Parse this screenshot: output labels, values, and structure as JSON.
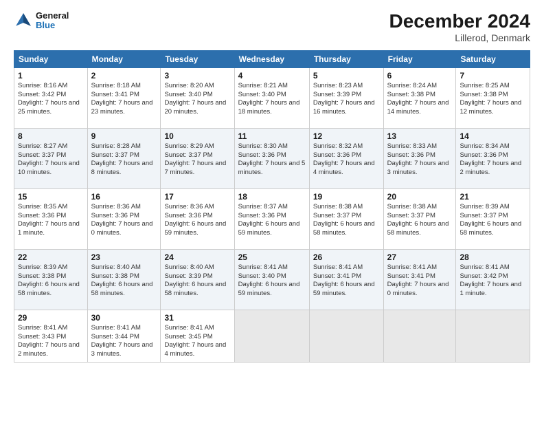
{
  "header": {
    "logo_line1": "General",
    "logo_line2": "Blue",
    "title": "December 2024",
    "subtitle": "Lillerod, Denmark"
  },
  "days_of_week": [
    "Sunday",
    "Monday",
    "Tuesday",
    "Wednesday",
    "Thursday",
    "Friday",
    "Saturday"
  ],
  "weeks": [
    [
      {
        "day": 1,
        "sunrise": "8:16 AM",
        "sunset": "3:42 PM",
        "daylight": "7 hours and 25 minutes."
      },
      {
        "day": 2,
        "sunrise": "8:18 AM",
        "sunset": "3:41 PM",
        "daylight": "7 hours and 23 minutes."
      },
      {
        "day": 3,
        "sunrise": "8:20 AM",
        "sunset": "3:40 PM",
        "daylight": "7 hours and 20 minutes."
      },
      {
        "day": 4,
        "sunrise": "8:21 AM",
        "sunset": "3:40 PM",
        "daylight": "7 hours and 18 minutes."
      },
      {
        "day": 5,
        "sunrise": "8:23 AM",
        "sunset": "3:39 PM",
        "daylight": "7 hours and 16 minutes."
      },
      {
        "day": 6,
        "sunrise": "8:24 AM",
        "sunset": "3:38 PM",
        "daylight": "7 hours and 14 minutes."
      },
      {
        "day": 7,
        "sunrise": "8:25 AM",
        "sunset": "3:38 PM",
        "daylight": "7 hours and 12 minutes."
      }
    ],
    [
      {
        "day": 8,
        "sunrise": "8:27 AM",
        "sunset": "3:37 PM",
        "daylight": "7 hours and 10 minutes."
      },
      {
        "day": 9,
        "sunrise": "8:28 AM",
        "sunset": "3:37 PM",
        "daylight": "7 hours and 8 minutes."
      },
      {
        "day": 10,
        "sunrise": "8:29 AM",
        "sunset": "3:37 PM",
        "daylight": "7 hours and 7 minutes."
      },
      {
        "day": 11,
        "sunrise": "8:30 AM",
        "sunset": "3:36 PM",
        "daylight": "7 hours and 5 minutes."
      },
      {
        "day": 12,
        "sunrise": "8:32 AM",
        "sunset": "3:36 PM",
        "daylight": "7 hours and 4 minutes."
      },
      {
        "day": 13,
        "sunrise": "8:33 AM",
        "sunset": "3:36 PM",
        "daylight": "7 hours and 3 minutes."
      },
      {
        "day": 14,
        "sunrise": "8:34 AM",
        "sunset": "3:36 PM",
        "daylight": "7 hours and 2 minutes."
      }
    ],
    [
      {
        "day": 15,
        "sunrise": "8:35 AM",
        "sunset": "3:36 PM",
        "daylight": "7 hours and 1 minute."
      },
      {
        "day": 16,
        "sunrise": "8:36 AM",
        "sunset": "3:36 PM",
        "daylight": "7 hours and 0 minutes."
      },
      {
        "day": 17,
        "sunrise": "8:36 AM",
        "sunset": "3:36 PM",
        "daylight": "6 hours and 59 minutes."
      },
      {
        "day": 18,
        "sunrise": "8:37 AM",
        "sunset": "3:36 PM",
        "daylight": "6 hours and 59 minutes."
      },
      {
        "day": 19,
        "sunrise": "8:38 AM",
        "sunset": "3:37 PM",
        "daylight": "6 hours and 58 minutes."
      },
      {
        "day": 20,
        "sunrise": "8:38 AM",
        "sunset": "3:37 PM",
        "daylight": "6 hours and 58 minutes."
      },
      {
        "day": 21,
        "sunrise": "8:39 AM",
        "sunset": "3:37 PM",
        "daylight": "6 hours and 58 minutes."
      }
    ],
    [
      {
        "day": 22,
        "sunrise": "8:39 AM",
        "sunset": "3:38 PM",
        "daylight": "6 hours and 58 minutes."
      },
      {
        "day": 23,
        "sunrise": "8:40 AM",
        "sunset": "3:38 PM",
        "daylight": "6 hours and 58 minutes."
      },
      {
        "day": 24,
        "sunrise": "8:40 AM",
        "sunset": "3:39 PM",
        "daylight": "6 hours and 58 minutes."
      },
      {
        "day": 25,
        "sunrise": "8:41 AM",
        "sunset": "3:40 PM",
        "daylight": "6 hours and 59 minutes."
      },
      {
        "day": 26,
        "sunrise": "8:41 AM",
        "sunset": "3:41 PM",
        "daylight": "6 hours and 59 minutes."
      },
      {
        "day": 27,
        "sunrise": "8:41 AM",
        "sunset": "3:41 PM",
        "daylight": "7 hours and 0 minutes."
      },
      {
        "day": 28,
        "sunrise": "8:41 AM",
        "sunset": "3:42 PM",
        "daylight": "7 hours and 1 minute."
      }
    ],
    [
      {
        "day": 29,
        "sunrise": "8:41 AM",
        "sunset": "3:43 PM",
        "daylight": "7 hours and 2 minutes."
      },
      {
        "day": 30,
        "sunrise": "8:41 AM",
        "sunset": "3:44 PM",
        "daylight": "7 hours and 3 minutes."
      },
      {
        "day": 31,
        "sunrise": "8:41 AM",
        "sunset": "3:45 PM",
        "daylight": "7 hours and 4 minutes."
      },
      null,
      null,
      null,
      null
    ]
  ]
}
